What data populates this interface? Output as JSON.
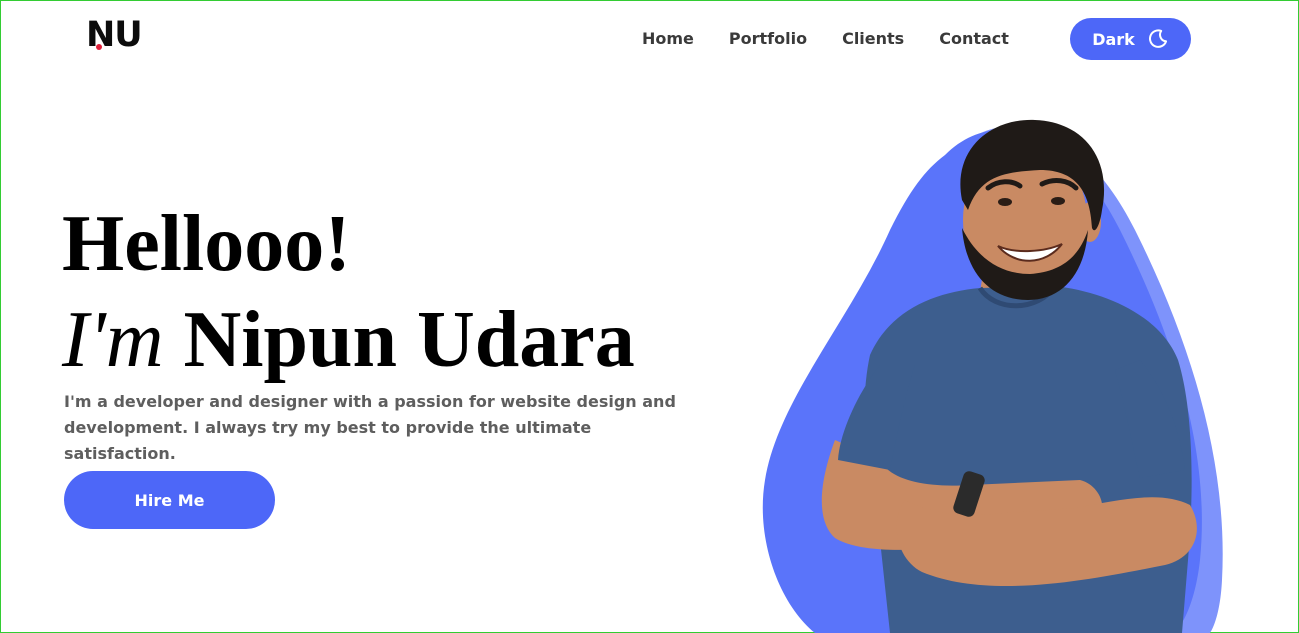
{
  "logo": {
    "text": "NU",
    "dot_color": "#e0203a"
  },
  "nav": {
    "items": [
      {
        "label": "Home"
      },
      {
        "label": "Portfolio"
      },
      {
        "label": "Clients"
      },
      {
        "label": "Contact"
      }
    ],
    "dark_toggle": {
      "label": "Dark",
      "icon": "moon-icon"
    }
  },
  "hero": {
    "greeting": "Hellooo!",
    "im": "I'm",
    "name": "Nipun Udara",
    "intro": "I'm a developer and designer with a passion for website design and development. I always try my best to provide the ultimate satisfaction.",
    "cta_label": "Hire Me",
    "image_alt": "person-portrait"
  },
  "colors": {
    "accent": "#4d67f8",
    "blob": "#5a74fa",
    "blob_shade": "#7e93fb",
    "text_dark": "#000000",
    "text_body": "#5e5e5e",
    "shirt": "#3d5e8e",
    "skin": "#c98a63",
    "hair": "#1f1a17"
  }
}
